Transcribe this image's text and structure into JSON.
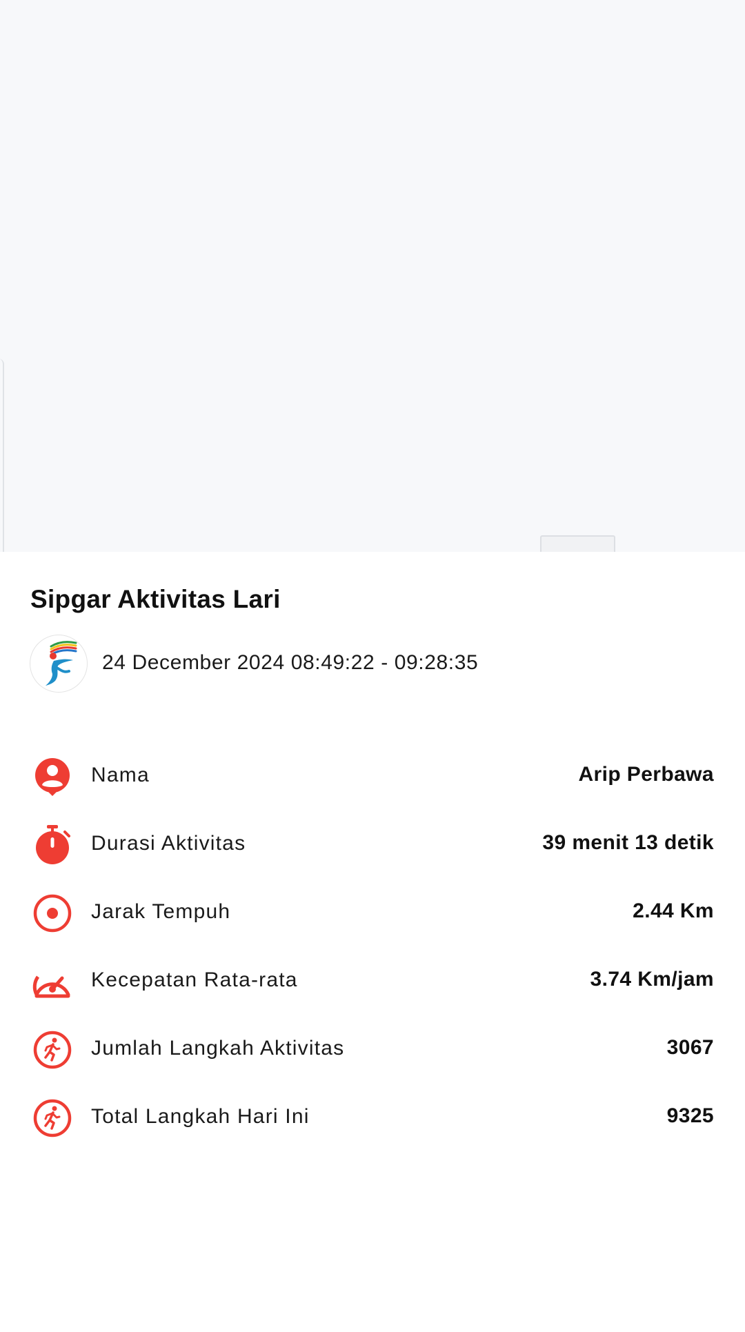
{
  "colors": {
    "accent": "#ee3d33",
    "map_background": "#f7f8fa"
  },
  "card": {
    "title": "Sipgar Aktivitas Lari",
    "logo_icon": "running-figure-logo-icon",
    "datetime": "24 December 2024 08:49:22 - 09:28:35"
  },
  "stats": [
    {
      "icon": "person-pin-icon",
      "label": "Nama",
      "value": "Arip Perbawa"
    },
    {
      "icon": "stopwatch-icon",
      "label": "Durasi Aktivitas",
      "value": "39 menit 13 detik"
    },
    {
      "icon": "target-icon",
      "label": "Jarak Tempuh",
      "value": "2.44 Km"
    },
    {
      "icon": "speedometer-icon",
      "label": "Kecepatan Rata-rata",
      "value": "3.74 Km/jam"
    },
    {
      "icon": "runner-icon",
      "label": "Jumlah Langkah Aktivitas",
      "value": "3067"
    },
    {
      "icon": "runner-icon",
      "label": "Total Langkah Hari Ini",
      "value": "9325"
    }
  ]
}
